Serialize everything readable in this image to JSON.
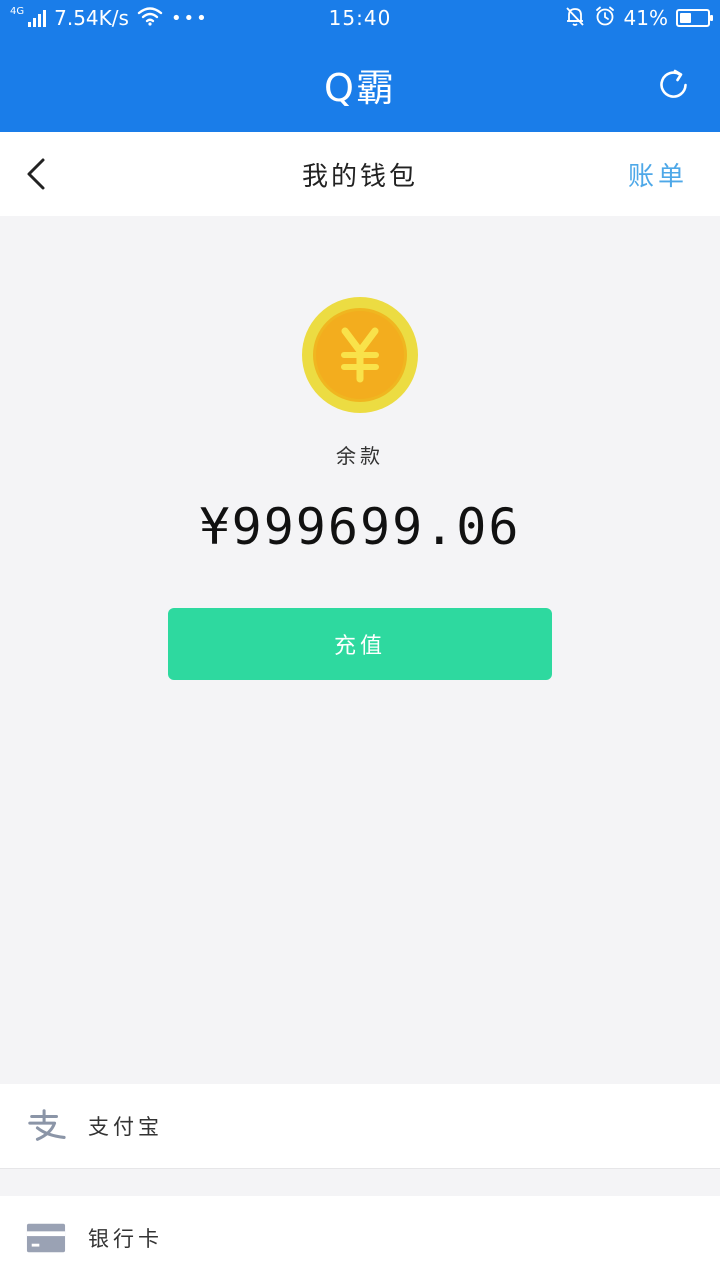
{
  "status_bar": {
    "network_type": "4G",
    "speed": "7.54K/s",
    "more": "•••",
    "time": "15:40",
    "battery_percent_text": "41%",
    "battery_level": 0.41,
    "icons": [
      "signal-icon",
      "wifi-icon",
      "mute-bell-icon",
      "alarm-icon",
      "battery-icon"
    ]
  },
  "header": {
    "title": "Q霸",
    "refresh_icon": "refresh-icon"
  },
  "nav": {
    "back_icon": "chevron-left-icon",
    "title": "我的钱包",
    "bill_label": "账单"
  },
  "wallet": {
    "coin_icon": "yuan-coin-icon",
    "balance_label": "余款",
    "balance_amount": "¥999699.06",
    "recharge_label": "充值"
  },
  "payment_methods": [
    {
      "icon": "alipay-icon",
      "label": "支付宝"
    },
    {
      "icon": "bank-card-icon",
      "label": "银行卡"
    }
  ],
  "colors": {
    "primary_blue": "#1a7de9",
    "button_green": "#2ed99f",
    "link_blue": "#4ea8e8",
    "coin_gold": "#f2c51f",
    "background": "#f4f4f6"
  }
}
